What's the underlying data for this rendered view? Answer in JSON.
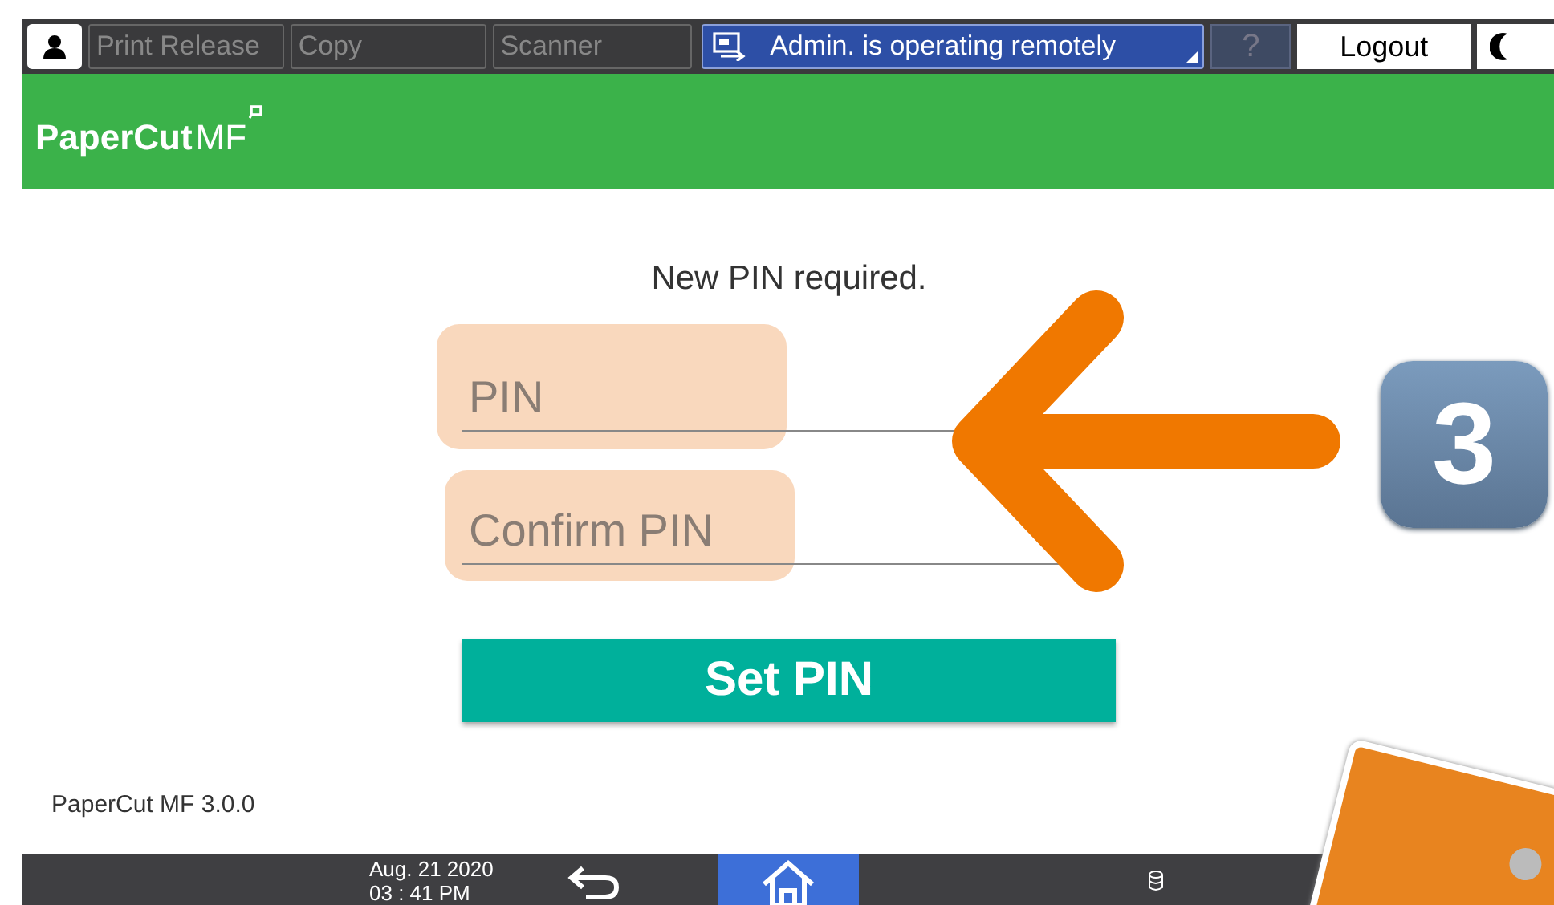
{
  "top_bar": {
    "tabs": [
      {
        "label": "Print Release"
      },
      {
        "label": "Copy"
      },
      {
        "label": "Scanner"
      }
    ],
    "remote_status": "Admin. is operating remotely",
    "help": "?",
    "logout": "Logout"
  },
  "header": {
    "logo": "PaperCut",
    "logo_suffix": "MF"
  },
  "form": {
    "heading": "New PIN required.",
    "fields": [
      {
        "placeholder": "PIN"
      },
      {
        "placeholder": "Confirm PIN"
      }
    ],
    "submit": "Set PIN"
  },
  "version": "PaperCut MF 3.0.0",
  "footer": {
    "date": "Aug. 21 2020",
    "time": "03 : 41 PM"
  },
  "annotation": {
    "step": "3"
  }
}
